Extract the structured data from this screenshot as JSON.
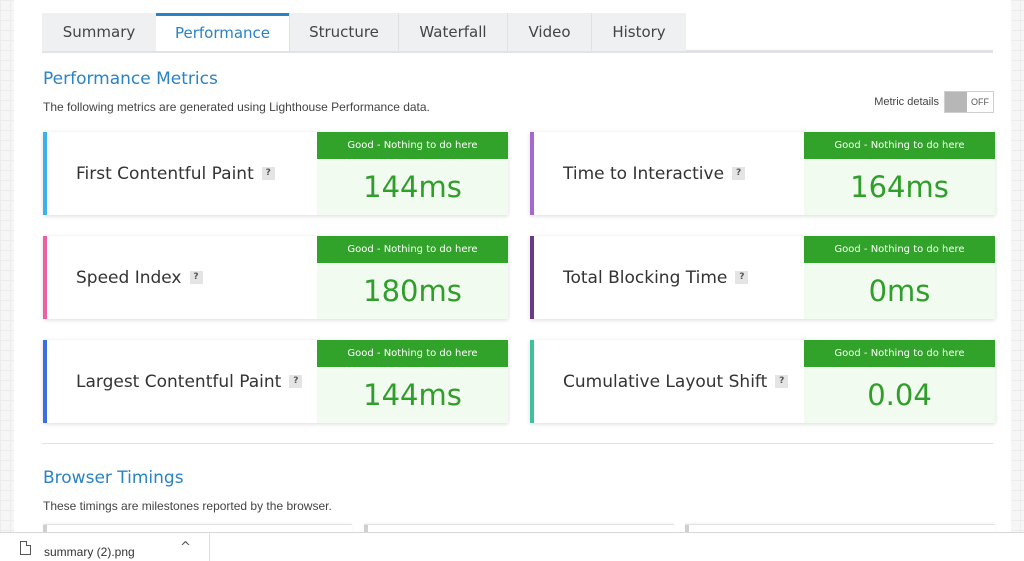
{
  "tabs": [
    {
      "label": "Summary",
      "active": false
    },
    {
      "label": "Performance",
      "active": true
    },
    {
      "label": "Structure",
      "active": false
    },
    {
      "label": "Waterfall",
      "active": false
    },
    {
      "label": "Video",
      "active": false
    },
    {
      "label": "History",
      "active": false
    }
  ],
  "performance": {
    "title": "Performance Metrics",
    "description": "The following metrics are generated using Lighthouse Performance data.",
    "toggle_label": "Metric details",
    "toggle_state": "OFF",
    "metrics": [
      {
        "label": "First Contentful Paint",
        "grade": "Good - Nothing to do here",
        "value": "144ms",
        "accent": "#3db1e9",
        "help": "?"
      },
      {
        "label": "Time to Interactive",
        "grade": "Good - Nothing to do here",
        "value": "164ms",
        "accent": "#a568cf",
        "help": "?"
      },
      {
        "label": "Speed Index",
        "grade": "Good - Nothing to do here",
        "value": "180ms",
        "accent": "#ec5fa0",
        "help": "?"
      },
      {
        "label": "Total Blocking Time",
        "grade": "Good - Nothing to do here",
        "value": "0ms",
        "accent": "#6a3a87",
        "help": "?"
      },
      {
        "label": "Largest Contentful Paint",
        "grade": "Good - Nothing to do here",
        "value": "144ms",
        "accent": "#3b6fe0",
        "help": "?"
      },
      {
        "label": "Cumulative Layout Shift",
        "grade": "Good - Nothing to do here",
        "value": "0.04",
        "accent": "#3fc19e",
        "help": "?"
      }
    ]
  },
  "browser_timings": {
    "title": "Browser Timings",
    "description": "These timings are milestones reported by the browser."
  },
  "colors": {
    "accent_blue": "#2a83c5",
    "good_green": "#32a32a",
    "value_green": "#2f9e2a"
  },
  "download_bar": {
    "file_name": "summary (2).png",
    "chevron": "^"
  }
}
